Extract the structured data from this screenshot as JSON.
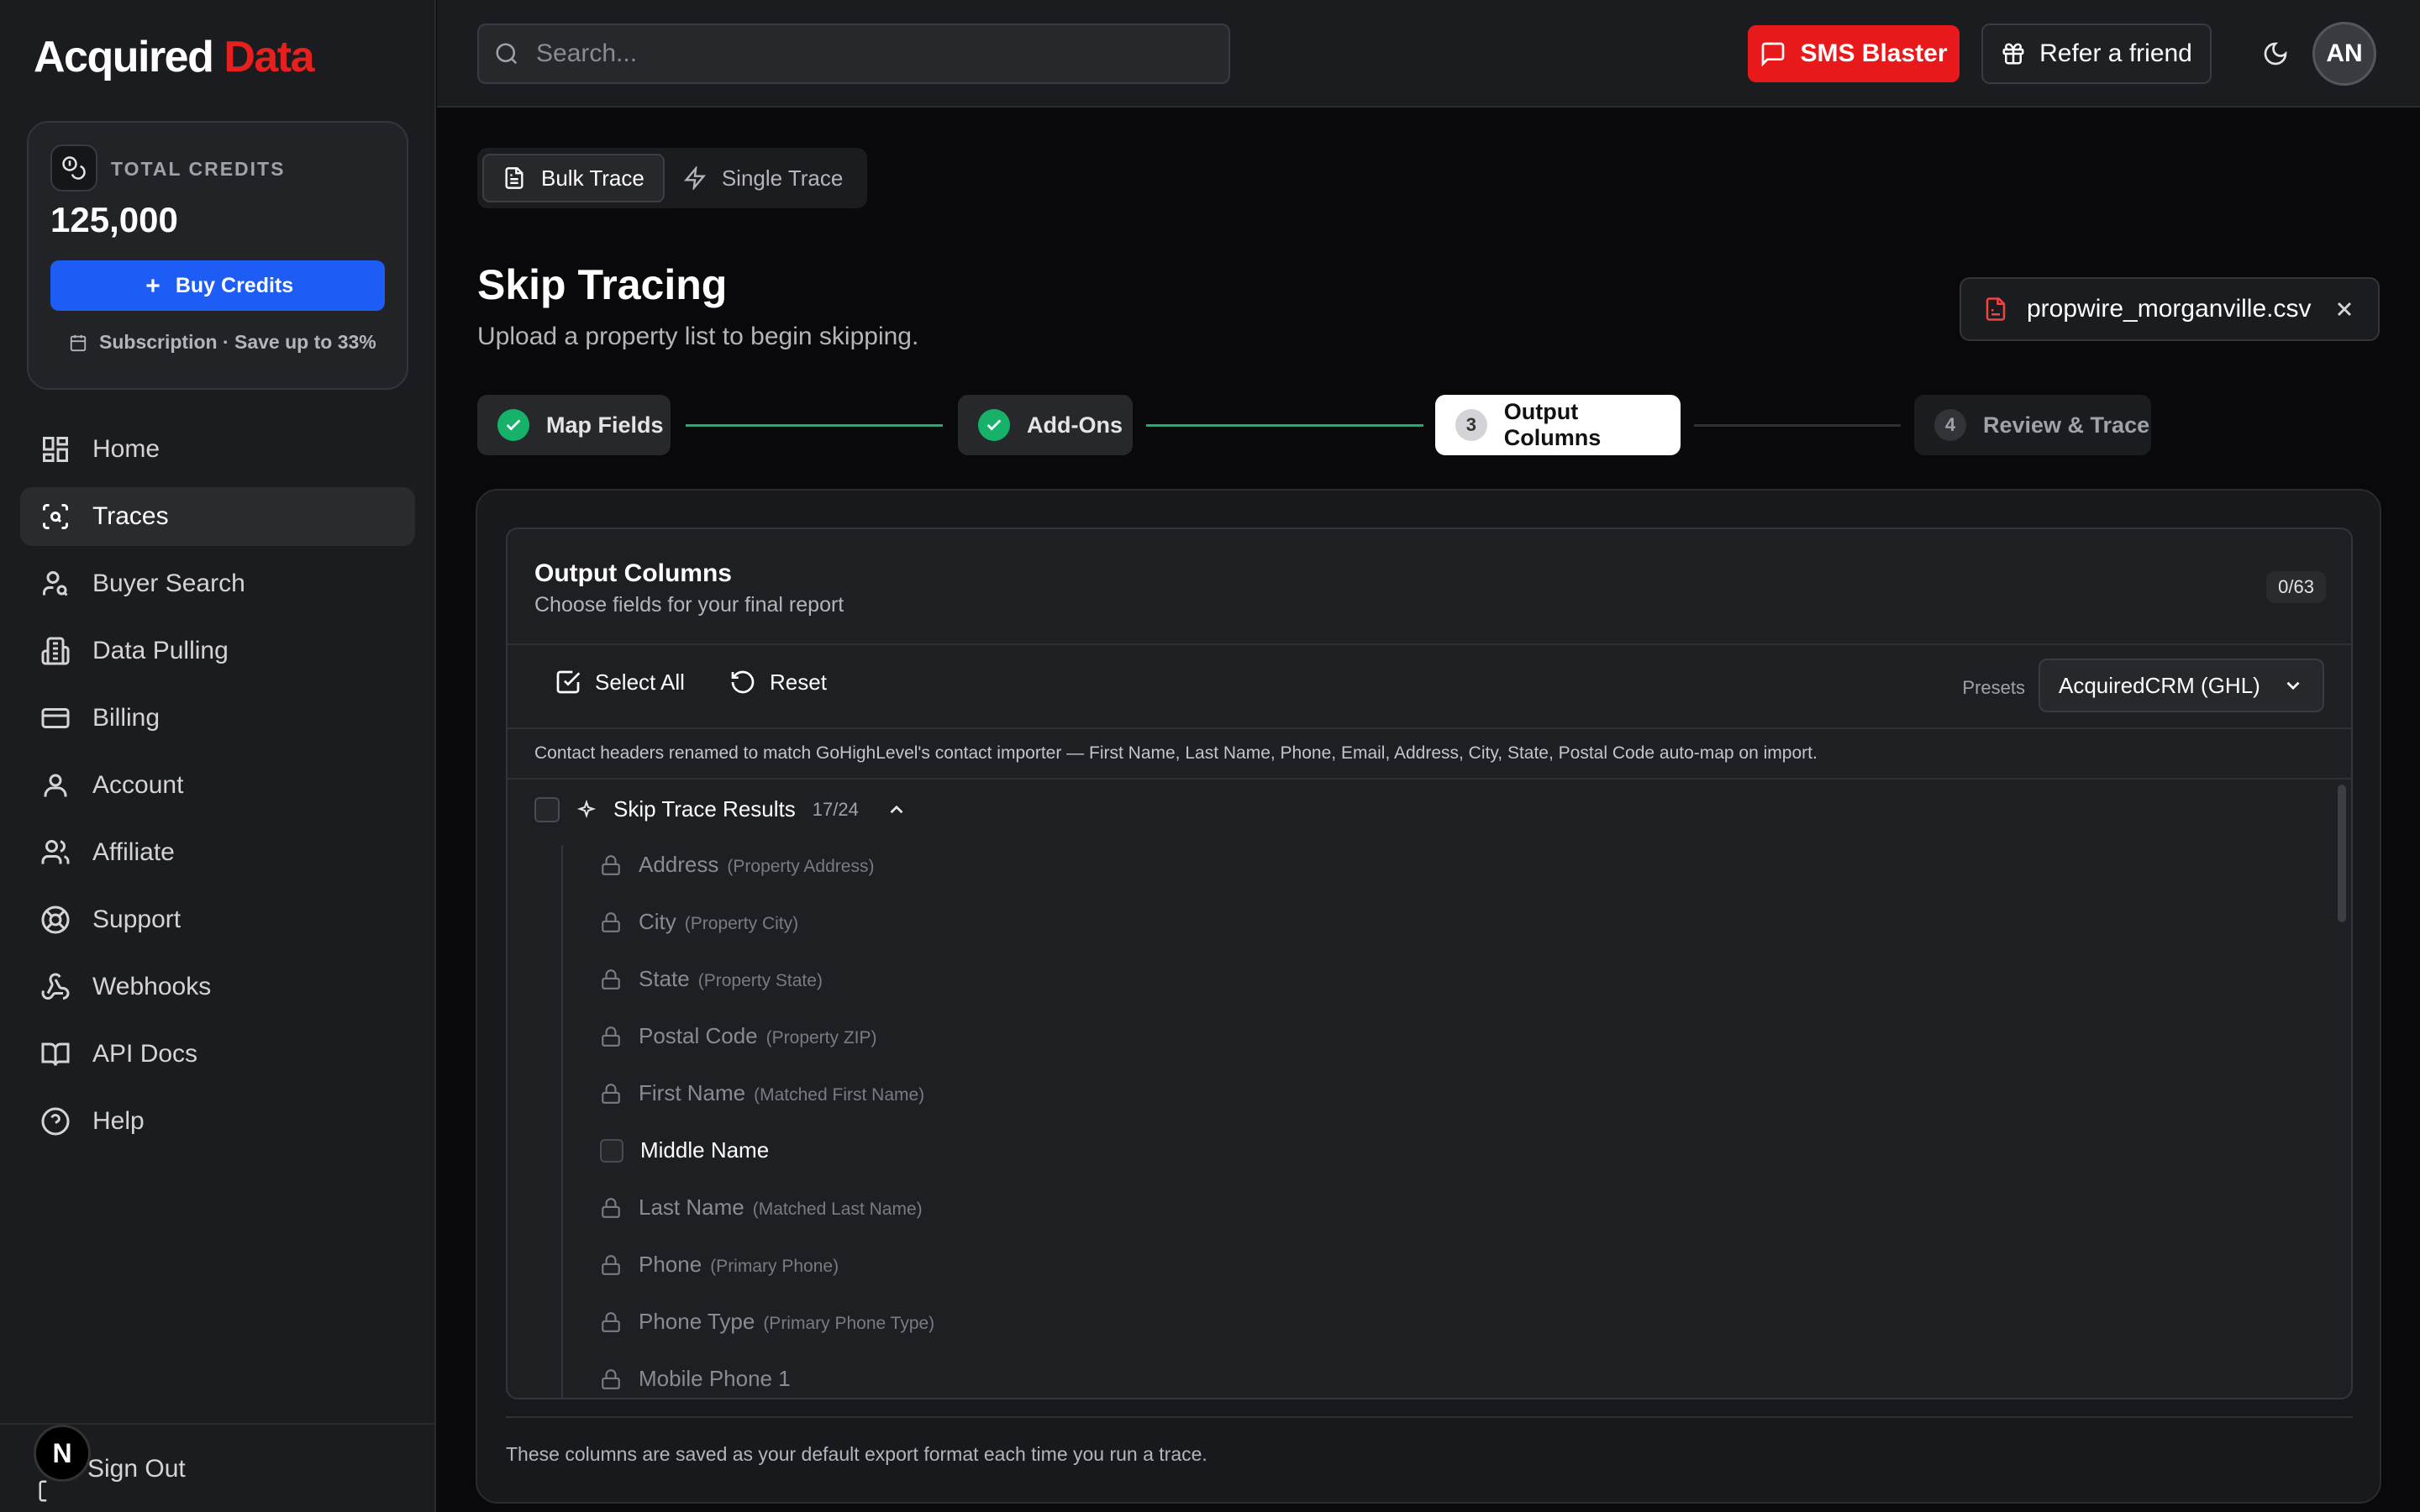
{
  "brand": {
    "name_part1": "Acquired",
    "name_part2": "Data",
    "accent_color": "#e5201f"
  },
  "credits": {
    "label": "TOTAL CREDITS",
    "value": "125,000",
    "buy_label": "Buy Credits",
    "subscription_text": "Subscription · Save up to 33%"
  },
  "nav": {
    "items": [
      {
        "label": "Home",
        "icon": "grid-icon"
      },
      {
        "label": "Traces",
        "icon": "scan-search-icon",
        "active": true
      },
      {
        "label": "Buyer Search",
        "icon": "user-search-icon"
      },
      {
        "label": "Data Pulling",
        "icon": "building-icon"
      },
      {
        "label": "Billing",
        "icon": "credit-card-icon"
      },
      {
        "label": "Account",
        "icon": "user-icon"
      },
      {
        "label": "Affiliate",
        "icon": "users-icon"
      },
      {
        "label": "Support",
        "icon": "lifebuoy-icon"
      },
      {
        "label": "Webhooks",
        "icon": "webhook-icon"
      },
      {
        "label": "API Docs",
        "icon": "book-icon"
      },
      {
        "label": "Help",
        "icon": "help-circle-icon"
      }
    ],
    "sign_out": "Sign Out",
    "n_badge": "N"
  },
  "topbar": {
    "search_placeholder": "Search...",
    "sms_label": "SMS Blaster",
    "refer_label": "Refer a friend",
    "avatar_initials": "AN",
    "sms_color": "#e8191a"
  },
  "mode_tabs": {
    "bulk": "Bulk Trace",
    "single": "Single Trace"
  },
  "page": {
    "title": "Skip Tracing",
    "subtitle": "Upload a property list to begin skipping.",
    "file_name": "propwire_morganville.csv"
  },
  "steps": [
    {
      "label": "Map Fields",
      "state": "done"
    },
    {
      "label": "Add-Ons",
      "state": "done"
    },
    {
      "label": "Output Columns",
      "number": "3",
      "state": "current"
    },
    {
      "label": "Review & Trace",
      "number": "4",
      "state": "pending"
    }
  ],
  "output": {
    "title": "Output Columns",
    "subtitle": "Choose fields for your final report",
    "count": "0/63",
    "select_all": "Select All",
    "reset": "Reset",
    "presets_label": "Presets",
    "preset_value": "AcquiredCRM (GHL)",
    "notice": "Contact headers renamed to match GoHighLevel's contact importer — First Name, Last Name, Phone, Email, Address, City, State, Postal Code auto-map on import.",
    "group": {
      "name": "Skip Trace Results",
      "count": "17/24"
    },
    "fields": [
      {
        "label": "Address",
        "hint": "(Property Address)",
        "locked": true
      },
      {
        "label": "City",
        "hint": "(Property City)",
        "locked": true
      },
      {
        "label": "State",
        "hint": "(Property State)",
        "locked": true
      },
      {
        "label": "Postal Code",
        "hint": "(Property ZIP)",
        "locked": true
      },
      {
        "label": "First Name",
        "hint": "(Matched First Name)",
        "locked": true
      },
      {
        "label": "Middle Name",
        "hint": "",
        "locked": false
      },
      {
        "label": "Last Name",
        "hint": "(Matched Last Name)",
        "locked": true
      },
      {
        "label": "Phone",
        "hint": "(Primary Phone)",
        "locked": true
      },
      {
        "label": "Phone Type",
        "hint": "(Primary Phone Type)",
        "locked": true
      },
      {
        "label": "Mobile Phone 1",
        "hint": "",
        "locked": true
      }
    ],
    "footer": "These columns are saved as your default export format each time you run a trace."
  }
}
